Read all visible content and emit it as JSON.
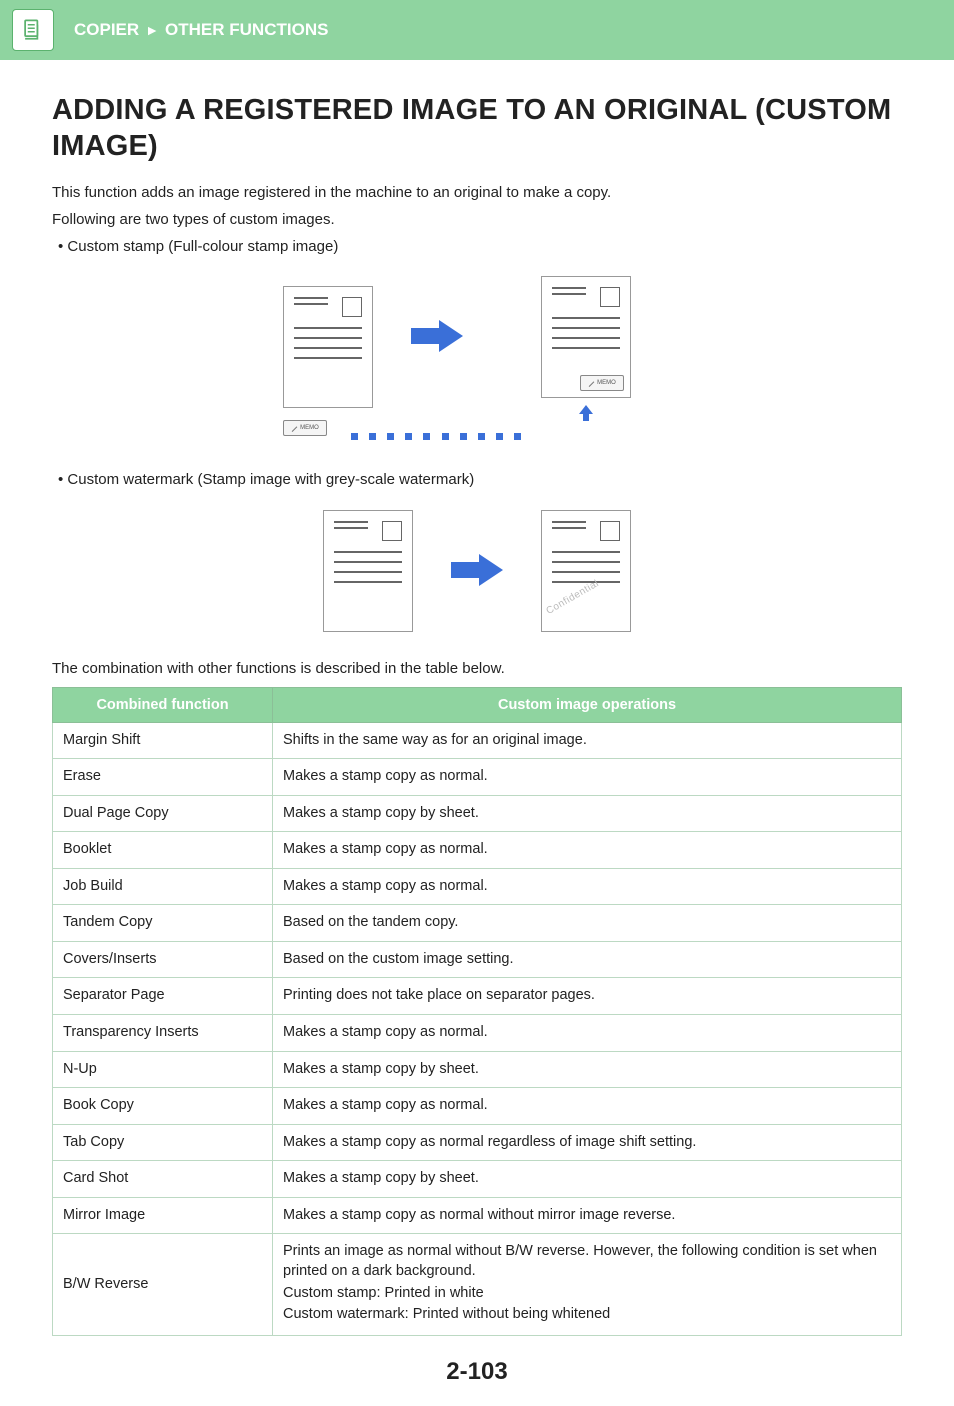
{
  "header": {
    "breadcrumb_1": "COPIER",
    "breadcrumb_2": "OTHER FUNCTIONS"
  },
  "title": "ADDING A REGISTERED IMAGE TO AN ORIGINAL (CUSTOM IMAGE)",
  "intro_line1": "This function adds an image registered in the machine to an original to make a copy.",
  "intro_line2": "Following are two types of custom images.",
  "bullet1": "• Custom stamp (Full-colour stamp image)",
  "bullet2": "• Custom watermark (Stamp image with grey-scale watermark)",
  "memo_label": "MEMO",
  "watermark_sample": "Confidential",
  "table_intro": "The combination with other functions is described in the table below.",
  "table": {
    "head1": "Combined function",
    "head2": "Custom image operations",
    "rows": [
      {
        "f": "Margin Shift",
        "op": "Shifts in the same way as for an original image."
      },
      {
        "f": "Erase",
        "op": "Makes a stamp copy as normal."
      },
      {
        "f": "Dual Page Copy",
        "op": "Makes a stamp copy by sheet."
      },
      {
        "f": "Booklet",
        "op": "Makes a stamp copy as normal."
      },
      {
        "f": "Job Build",
        "op": "Makes a stamp copy as normal."
      },
      {
        "f": "Tandem Copy",
        "op": "Based on the tandem copy."
      },
      {
        "f": "Covers/Inserts",
        "op": "Based on the custom image setting."
      },
      {
        "f": "Separator Page",
        "op": "Printing does not take place on separator pages."
      },
      {
        "f": "Transparency Inserts",
        "op": "Makes a stamp copy as normal."
      },
      {
        "f": "N-Up",
        "op": "Makes a stamp copy by sheet."
      },
      {
        "f": "Book Copy",
        "op": "Makes a stamp copy as normal."
      },
      {
        "f": "Tab Copy",
        "op": "Makes a stamp copy as normal regardless of image shift setting."
      },
      {
        "f": "Card Shot",
        "op": "Makes a stamp copy by sheet."
      },
      {
        "f": "Mirror Image",
        "op": "Makes a stamp copy as normal without mirror image reverse."
      }
    ],
    "bw_reverse": {
      "f": "B/W Reverse",
      "op1": "Prints an image as normal without B/W reverse. However, the following condition is set when printed on a dark background.",
      "op2": "Custom stamp: Printed in white",
      "op3": "Custom watermark: Printed without being whitened"
    }
  },
  "page_number": "2-103"
}
